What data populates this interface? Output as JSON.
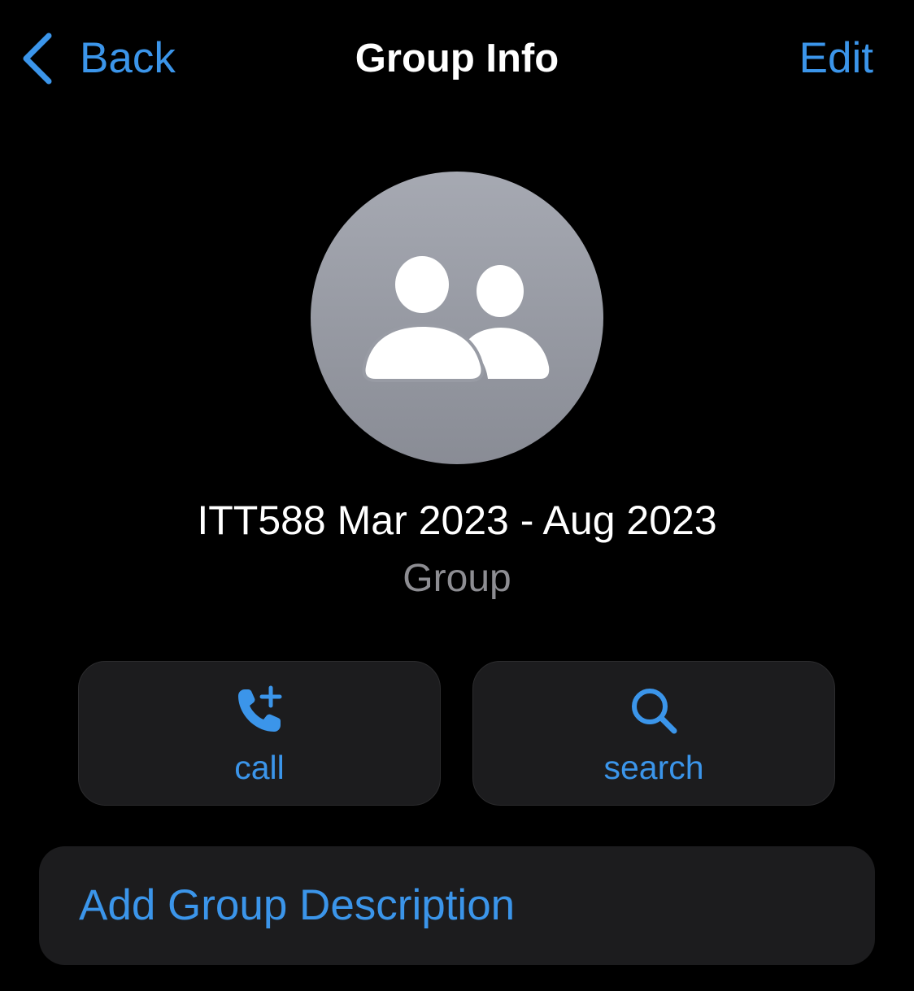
{
  "nav": {
    "back_label": "Back",
    "title": "Group Info",
    "edit_label": "Edit"
  },
  "group": {
    "name": "ITT588 Mar 2023 - Aug 2023",
    "subtitle": "Group",
    "avatar_icon": "group-people-icon"
  },
  "actions": {
    "call_label": "call",
    "call_icon": "phone-add-icon",
    "search_label": "search",
    "search_icon": "magnifier-icon"
  },
  "description": {
    "add_label": "Add Group Description"
  },
  "colors": {
    "accent": "#3b95ea",
    "background": "#000000",
    "card": "#1c1c1e",
    "secondary_text": "#8d8d92"
  }
}
